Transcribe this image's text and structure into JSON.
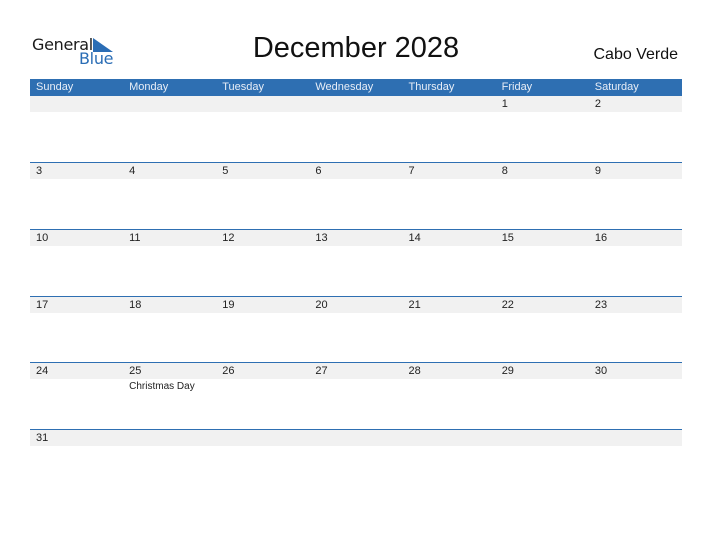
{
  "logo": {
    "word1": "General",
    "word2": "Blue",
    "accent": "#2a6db5"
  },
  "title": "December 2028",
  "country": "Cabo Verde",
  "colors": {
    "header_bg": "#2e6fb2",
    "strip_bg": "#f1f1f1"
  },
  "weekdays": [
    "Sunday",
    "Monday",
    "Tuesday",
    "Wednesday",
    "Thursday",
    "Friday",
    "Saturday"
  ],
  "weeks": [
    [
      {
        "day": ""
      },
      {
        "day": ""
      },
      {
        "day": ""
      },
      {
        "day": ""
      },
      {
        "day": ""
      },
      {
        "day": "1"
      },
      {
        "day": "2"
      }
    ],
    [
      {
        "day": "3"
      },
      {
        "day": "4"
      },
      {
        "day": "5"
      },
      {
        "day": "6"
      },
      {
        "day": "7"
      },
      {
        "day": "8"
      },
      {
        "day": "9"
      }
    ],
    [
      {
        "day": "10"
      },
      {
        "day": "11"
      },
      {
        "day": "12"
      },
      {
        "day": "13"
      },
      {
        "day": "14"
      },
      {
        "day": "15"
      },
      {
        "day": "16"
      }
    ],
    [
      {
        "day": "17"
      },
      {
        "day": "18"
      },
      {
        "day": "19"
      },
      {
        "day": "20"
      },
      {
        "day": "21"
      },
      {
        "day": "22"
      },
      {
        "day": "23"
      }
    ],
    [
      {
        "day": "24"
      },
      {
        "day": "25",
        "holiday": "Christmas Day"
      },
      {
        "day": "26"
      },
      {
        "day": "27"
      },
      {
        "day": "28"
      },
      {
        "day": "29"
      },
      {
        "day": "30"
      }
    ],
    [
      {
        "day": "31"
      },
      {
        "day": ""
      },
      {
        "day": ""
      },
      {
        "day": ""
      },
      {
        "day": ""
      },
      {
        "day": ""
      },
      {
        "day": ""
      }
    ]
  ]
}
